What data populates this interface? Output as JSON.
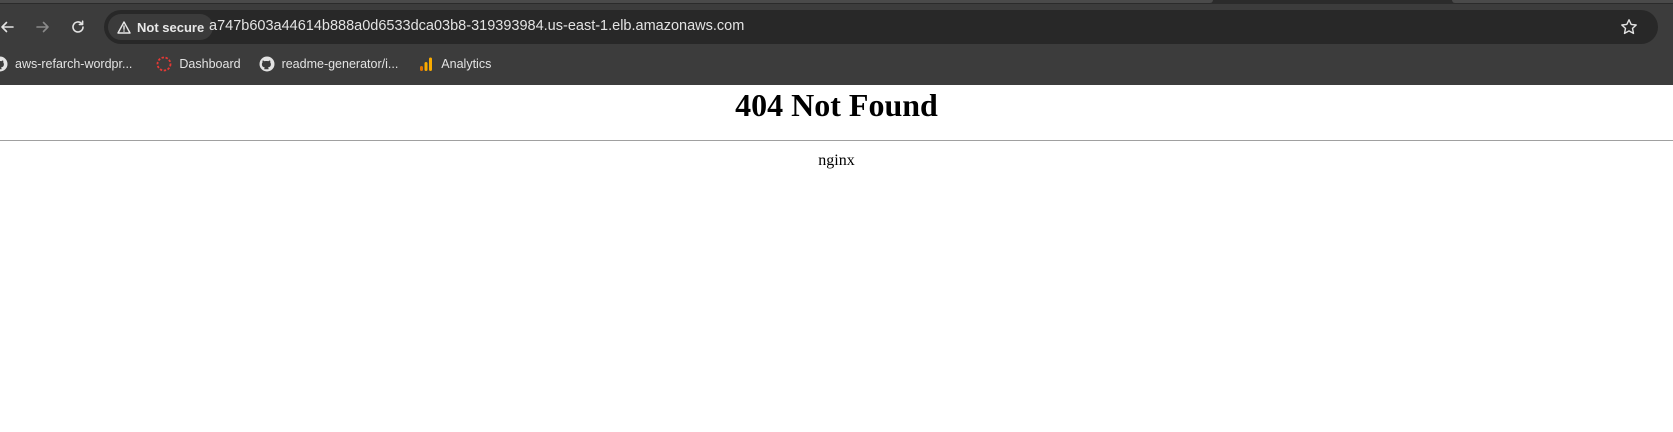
{
  "browser": {
    "security_chip": "Not secure",
    "url": "a747b603a44614b888a0d6533dca03b8-319393984.us-east-1.elb.amazonaws.com",
    "bookmarks": [
      {
        "label": "aws-refarch-wordpr...",
        "icon": "github-icon"
      },
      {
        "label": "Dashboard",
        "icon": "dashboard-icon"
      },
      {
        "label": "readme-generator/i...",
        "icon": "github-icon"
      },
      {
        "label": "Analytics",
        "icon": "analytics-icon"
      }
    ],
    "colors": {
      "chrome": "#3c3c3c",
      "omnibox": "#282828",
      "dashboard_icon": "#e53935",
      "analytics_icon": "#f9ab00"
    }
  },
  "page": {
    "heading": "404 Not Found",
    "server": "nginx"
  }
}
